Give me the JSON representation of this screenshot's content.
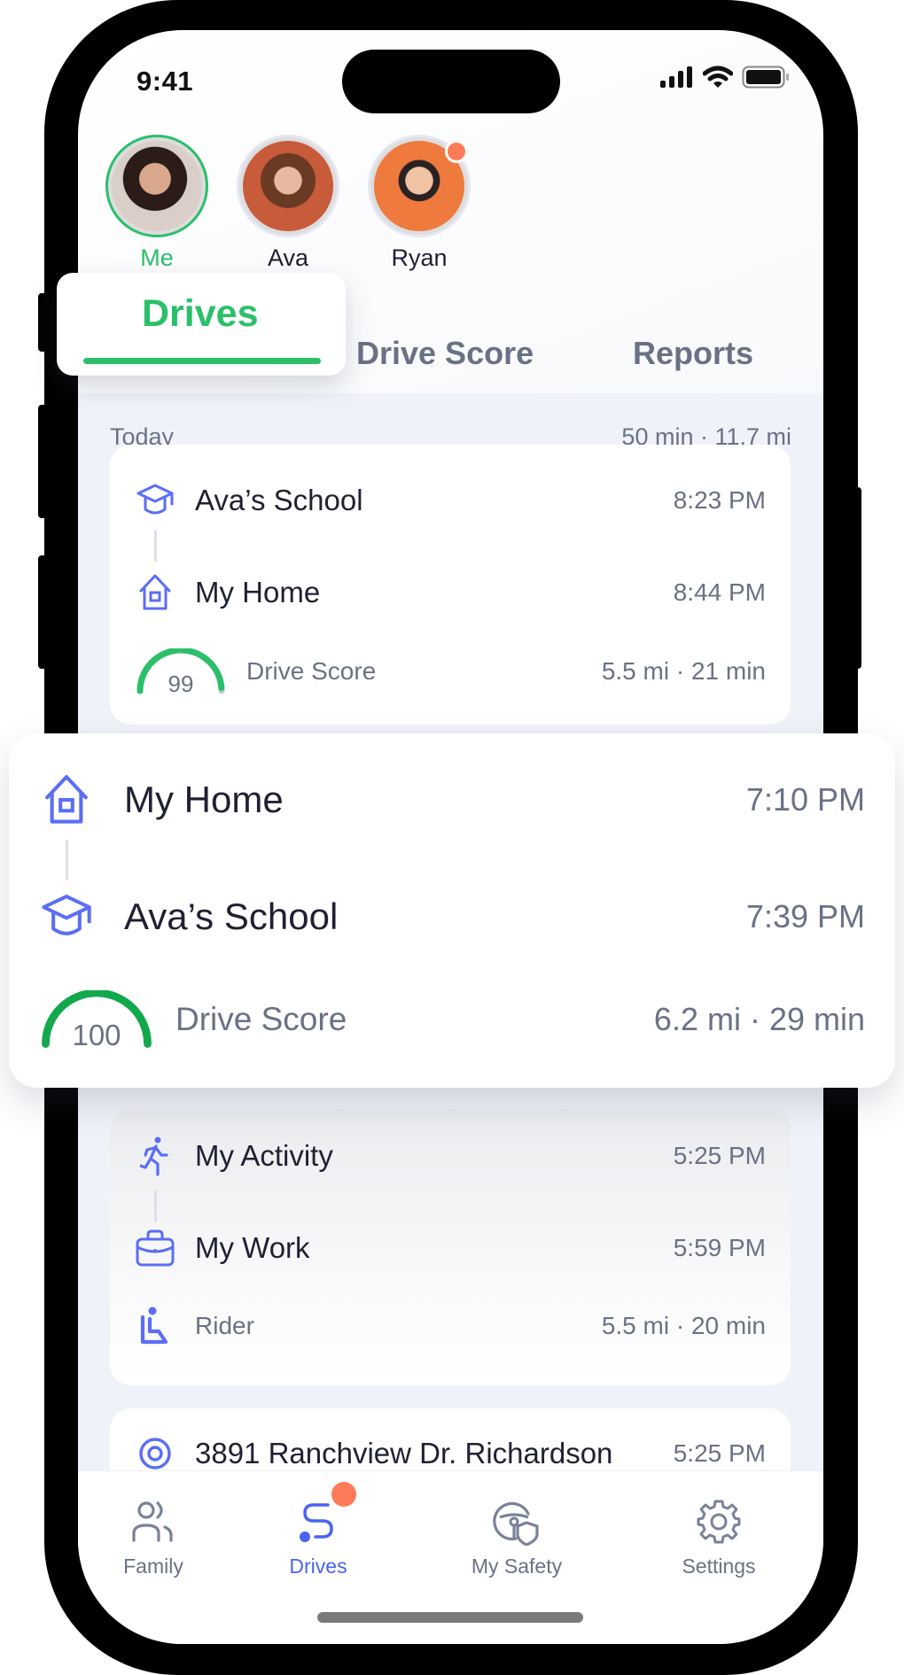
{
  "status_bar": {
    "time": "9:41"
  },
  "profiles": [
    {
      "name": "Me",
      "active": true,
      "has_notification": false
    },
    {
      "name": "Ava",
      "active": false,
      "has_notification": false
    },
    {
      "name": "Ryan",
      "active": false,
      "has_notification": true
    }
  ],
  "tabs": [
    {
      "label": "Drives",
      "active": true
    },
    {
      "label": "Drive Score",
      "active": false
    },
    {
      "label": "Reports",
      "active": false
    }
  ],
  "summary": {
    "day": "Today",
    "totals": "50 min · 11.7 mi"
  },
  "drives": [
    {
      "from": {
        "place": "Ava’s School",
        "time": "8:23 PM",
        "icon": "graduation-cap-icon"
      },
      "to": {
        "place": "My Home",
        "time": "8:44 PM",
        "icon": "home-icon"
      },
      "score": 99,
      "score_label": "Drive Score",
      "stats": "5.5 mi · 21 min"
    },
    {
      "from": {
        "place": "My Home",
        "time": "7:10 PM",
        "icon": "home-icon"
      },
      "to": {
        "place": "Ava’s School",
        "time": "7:39 PM",
        "icon": "graduation-cap-icon"
      },
      "score": 100,
      "score_label": "Drive Score",
      "stats": "6.2 mi · 29 min",
      "highlighted": true
    },
    {
      "from": {
        "place": "My Activity",
        "time": "5:25 PM",
        "icon": "running-icon"
      },
      "to": {
        "place": "My Work",
        "time": "5:59 PM",
        "icon": "briefcase-icon"
      },
      "role": "Rider",
      "role_icon": "rider-seat-icon",
      "stats": "5.5 mi · 20 min"
    },
    {
      "from": {
        "place": "3891 Ranchview Dr. Richardson",
        "time": "5:25 PM",
        "icon": "location-pin-icon"
      }
    }
  ],
  "bottom_nav": [
    {
      "label": "Family",
      "icon": "family-icon",
      "active": false
    },
    {
      "label": "Drives",
      "icon": "drives-route-icon",
      "active": true,
      "has_notification": true
    },
    {
      "label": "My Safety",
      "icon": "steering-shield-icon",
      "active": false
    },
    {
      "label": "Settings",
      "icon": "gear-icon",
      "active": false
    }
  ],
  "colors": {
    "accent_green": "#2bbf6a",
    "score_green_strong": "#12a84c",
    "accent_blue": "#4a63f2",
    "icon_blue": "#5b6ef5",
    "notification": "#ff7a59",
    "muted_text": "#6b7185",
    "primary_text": "#1f2133"
  }
}
